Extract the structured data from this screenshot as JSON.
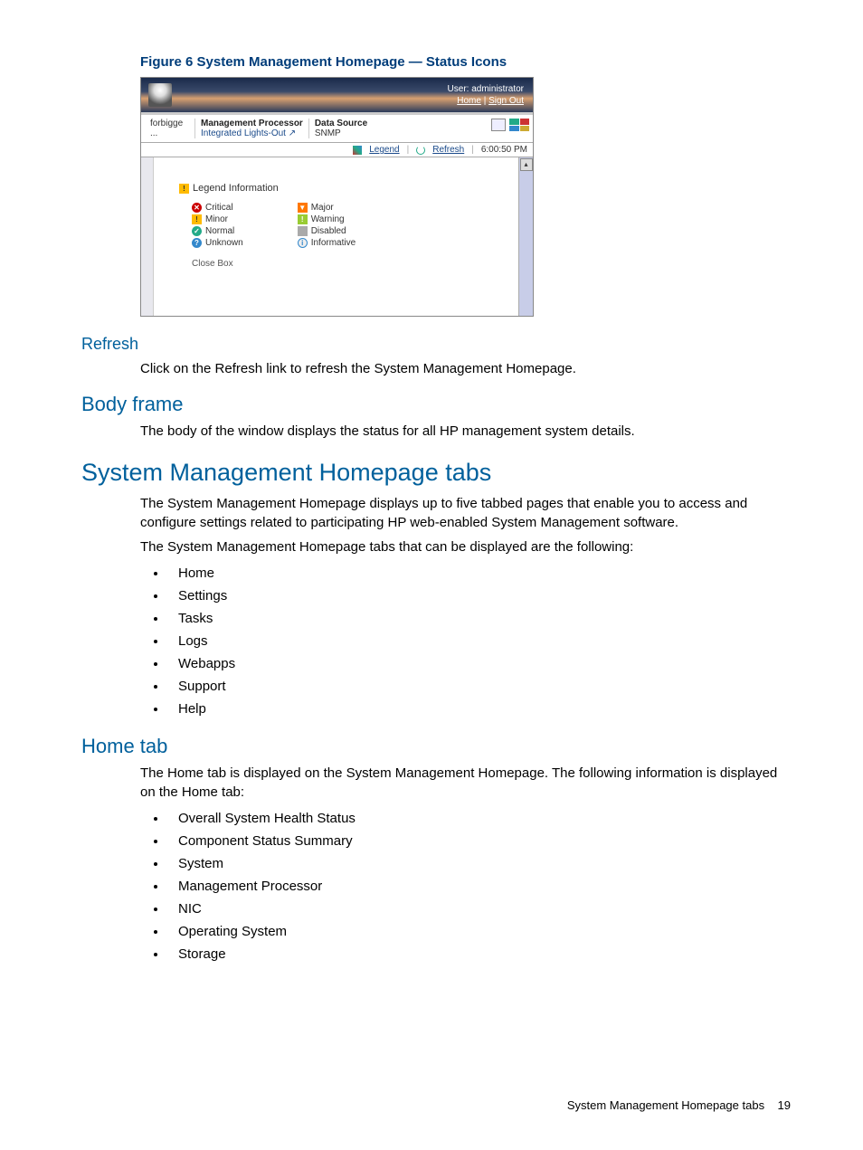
{
  "figure": {
    "caption": "Figure 6 System Management Homepage — Status Icons"
  },
  "screenshot": {
    "banner": {
      "user_label": "User: administrator",
      "home_link": "Home",
      "signout_link": "Sign Out"
    },
    "toolbar": {
      "host": "forbigge ...",
      "mp_label": "Management Processor",
      "mp_value": "Integrated Lights-Out  ↗",
      "ds_label": "Data Source",
      "ds_value": "SNMP"
    },
    "subbar": {
      "legend_link": "Legend",
      "refresh_link": "Refresh",
      "time": "6:00:50 PM"
    },
    "legend": {
      "title": "Legend Information",
      "col1": [
        "Critical",
        "Minor",
        "Normal",
        "Unknown"
      ],
      "col2": [
        "Major",
        "Warning",
        "Disabled",
        "Informative"
      ],
      "close": "Close Box"
    }
  },
  "sections": {
    "refresh": {
      "heading": "Refresh",
      "text": "Click on the Refresh link to refresh the System Management Homepage."
    },
    "bodyframe": {
      "heading": "Body frame",
      "text": "The body of the window displays the status for all HP management system details."
    },
    "tabs": {
      "heading": "System Management Homepage tabs",
      "p1": "The System Management Homepage displays up to five tabbed pages that enable you to access and configure settings related to participating HP web-enabled System Management software.",
      "p2": "The System Management Homepage tabs that can be displayed are the following:",
      "items": [
        "Home",
        "Settings",
        "Tasks",
        "Logs",
        "Webapps",
        "Support",
        "Help"
      ]
    },
    "hometab": {
      "heading": "Home tab",
      "p1": "The Home tab is displayed on the System Management Homepage. The following information is displayed on the Home tab:",
      "items": [
        "Overall System Health Status",
        "Component Status Summary",
        "System",
        "Management Processor",
        "NIC",
        "Operating System",
        "Storage"
      ]
    }
  },
  "footer": {
    "text": "System Management Homepage tabs",
    "page": "19"
  }
}
